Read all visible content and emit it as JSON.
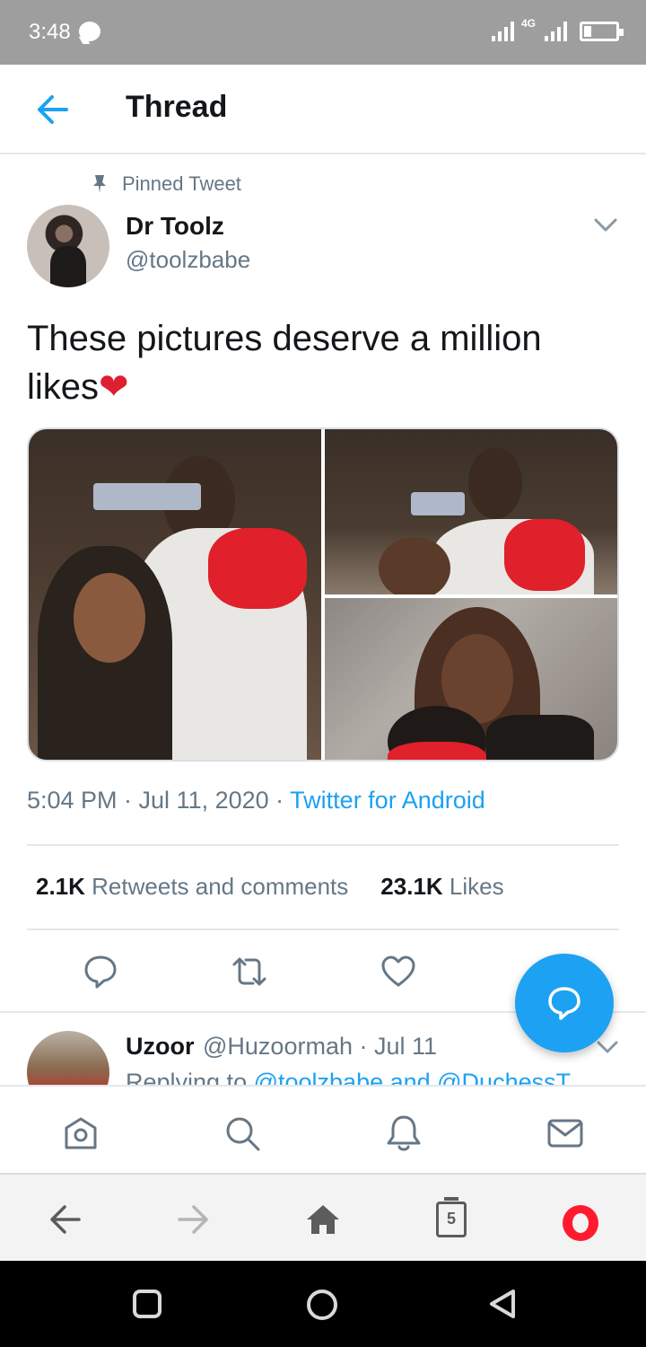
{
  "status_bar": {
    "time": "3:48",
    "network": "4G"
  },
  "header": {
    "title": "Thread"
  },
  "tweet": {
    "pinned_label": "Pinned Tweet",
    "author_name": "Dr Toolz",
    "author_handle": "@toolzbabe",
    "text": "These pictures deserve a million likes",
    "emoji": "❤",
    "timestamp": "5:04 PM · Jul 11, 2020 · ",
    "source": "Twitter for Android",
    "retweets_count": "2.1K",
    "retweets_label": "Retweets and comments",
    "likes_count": "23.1K",
    "likes_label": "Likes",
    "images_count": 3
  },
  "reply": {
    "name": "Uzoor",
    "handle_date": "@Huzoormah · Jul 11",
    "replying_prefix": "Replying to ",
    "replying_to": "@toolzbabe and @DuchessT"
  },
  "twitter_nav": [
    "home-icon",
    "search-icon",
    "notifications-icon",
    "messages-icon"
  ],
  "browser_bar": {
    "tabs_count": "5"
  },
  "colors": {
    "accent": "#1da1f2",
    "text": "#14171a",
    "muted": "#657786",
    "heart": "#dd1f2f",
    "opera": "#ff1b2d"
  }
}
